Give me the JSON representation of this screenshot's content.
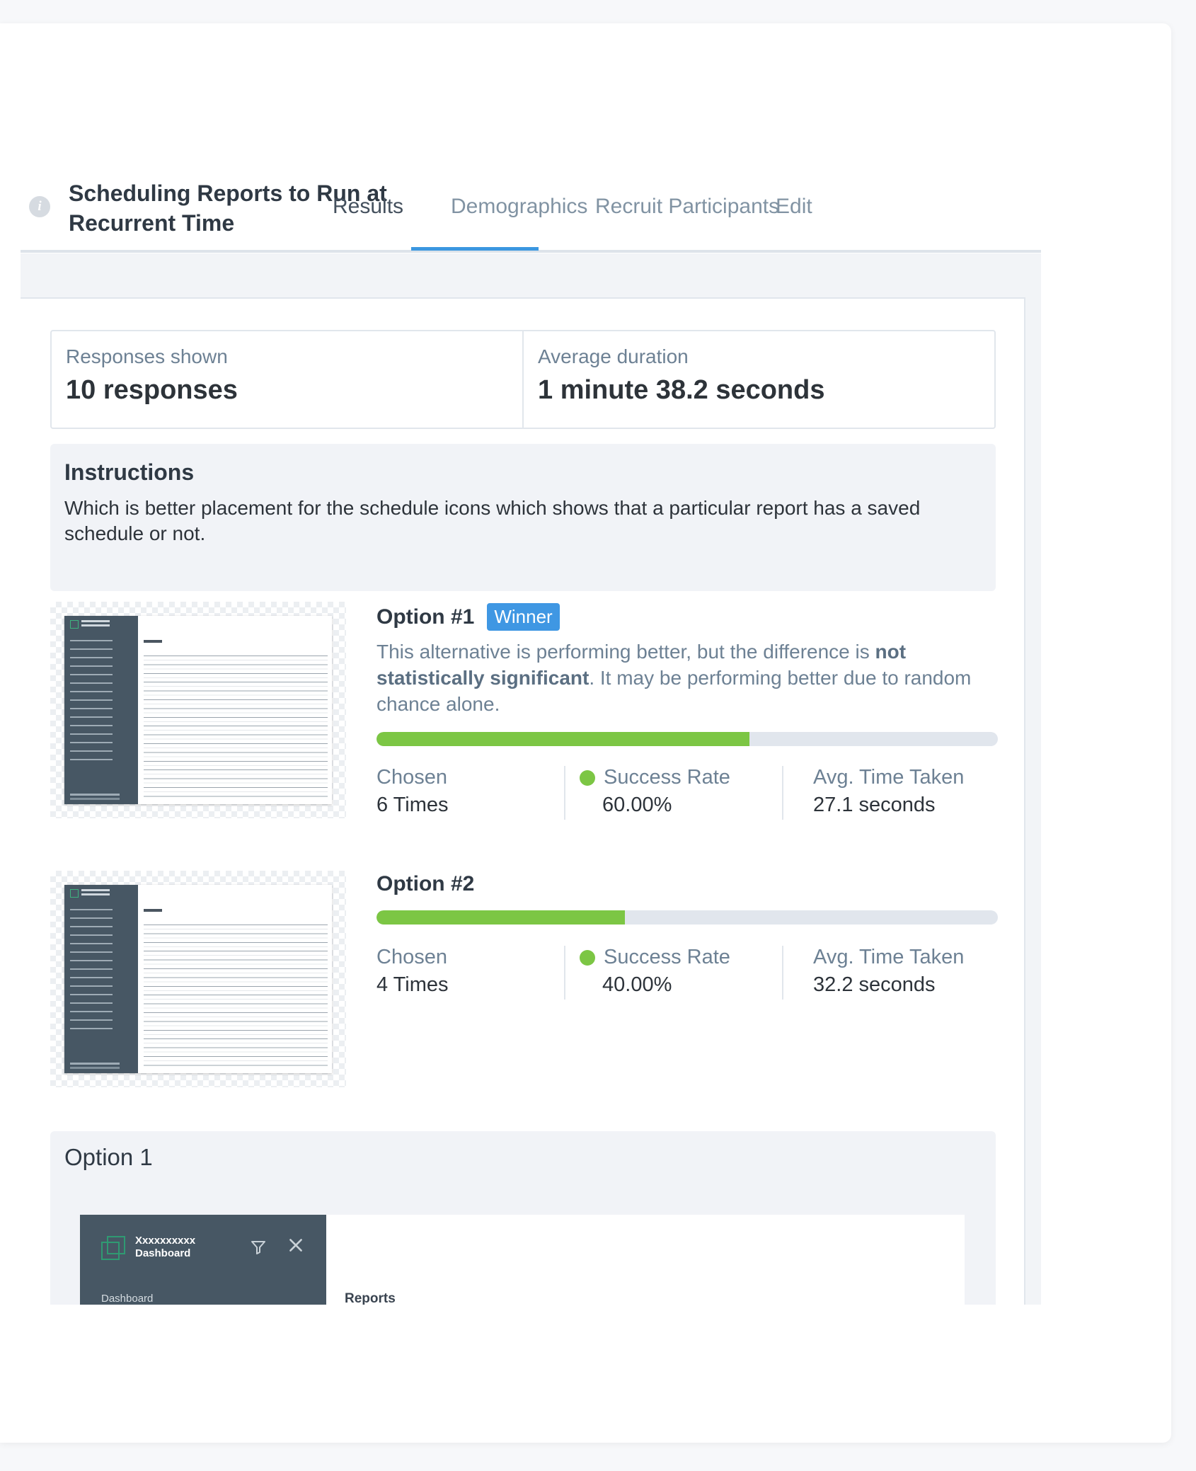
{
  "study": {
    "title": "Scheduling Reports to Run at Recurrent Time"
  },
  "tabs": [
    {
      "label": "Results",
      "active": true
    },
    {
      "label": "Demographics",
      "active": false
    },
    {
      "label": "Recruit Participants",
      "active": false
    },
    {
      "label": "Edit",
      "active": false
    }
  ],
  "stats": {
    "responses_label": "Responses shown",
    "responses_value": "10 responses",
    "duration_label": "Average duration",
    "duration_value": "1 minute 38.2 seconds"
  },
  "instructions": {
    "title": "Instructions",
    "text": "Which is better placement for the schedule icons which shows that a particular report has a saved schedule or not."
  },
  "options": [
    {
      "title": "Option #1",
      "badge": "Winner",
      "desc_pre": "This alternative is performing better, but the difference is ",
      "desc_bold": "not statistically significant",
      "desc_post": ". It may be performing better due to random chance alone.",
      "success_fraction": 0.6,
      "chosen_label": "Chosen",
      "chosen_value": "6 Times",
      "success_label": "Success Rate",
      "success_value": "60.00%",
      "time_label": "Avg. Time Taken",
      "time_value": "27.1 seconds"
    },
    {
      "title": "Option #2",
      "success_fraction": 0.4,
      "chosen_label": "Chosen",
      "chosen_value": "4 Times",
      "success_label": "Success Rate",
      "success_value": "40.00%",
      "time_label": "Avg. Time Taken",
      "time_value": "32.2 seconds"
    }
  ],
  "option_preview": {
    "title": "Option 1",
    "brand_line1": "Xxxxxxxxxx",
    "brand_line2": "Dashboard",
    "nav_first": "Dashboard",
    "heading": "Reports",
    "filter_icon": "filter-icon",
    "close_icon": "close-icon"
  },
  "colors": {
    "accent": "#3b97e0",
    "success": "#7cc644",
    "sidebar": "#475764"
  }
}
